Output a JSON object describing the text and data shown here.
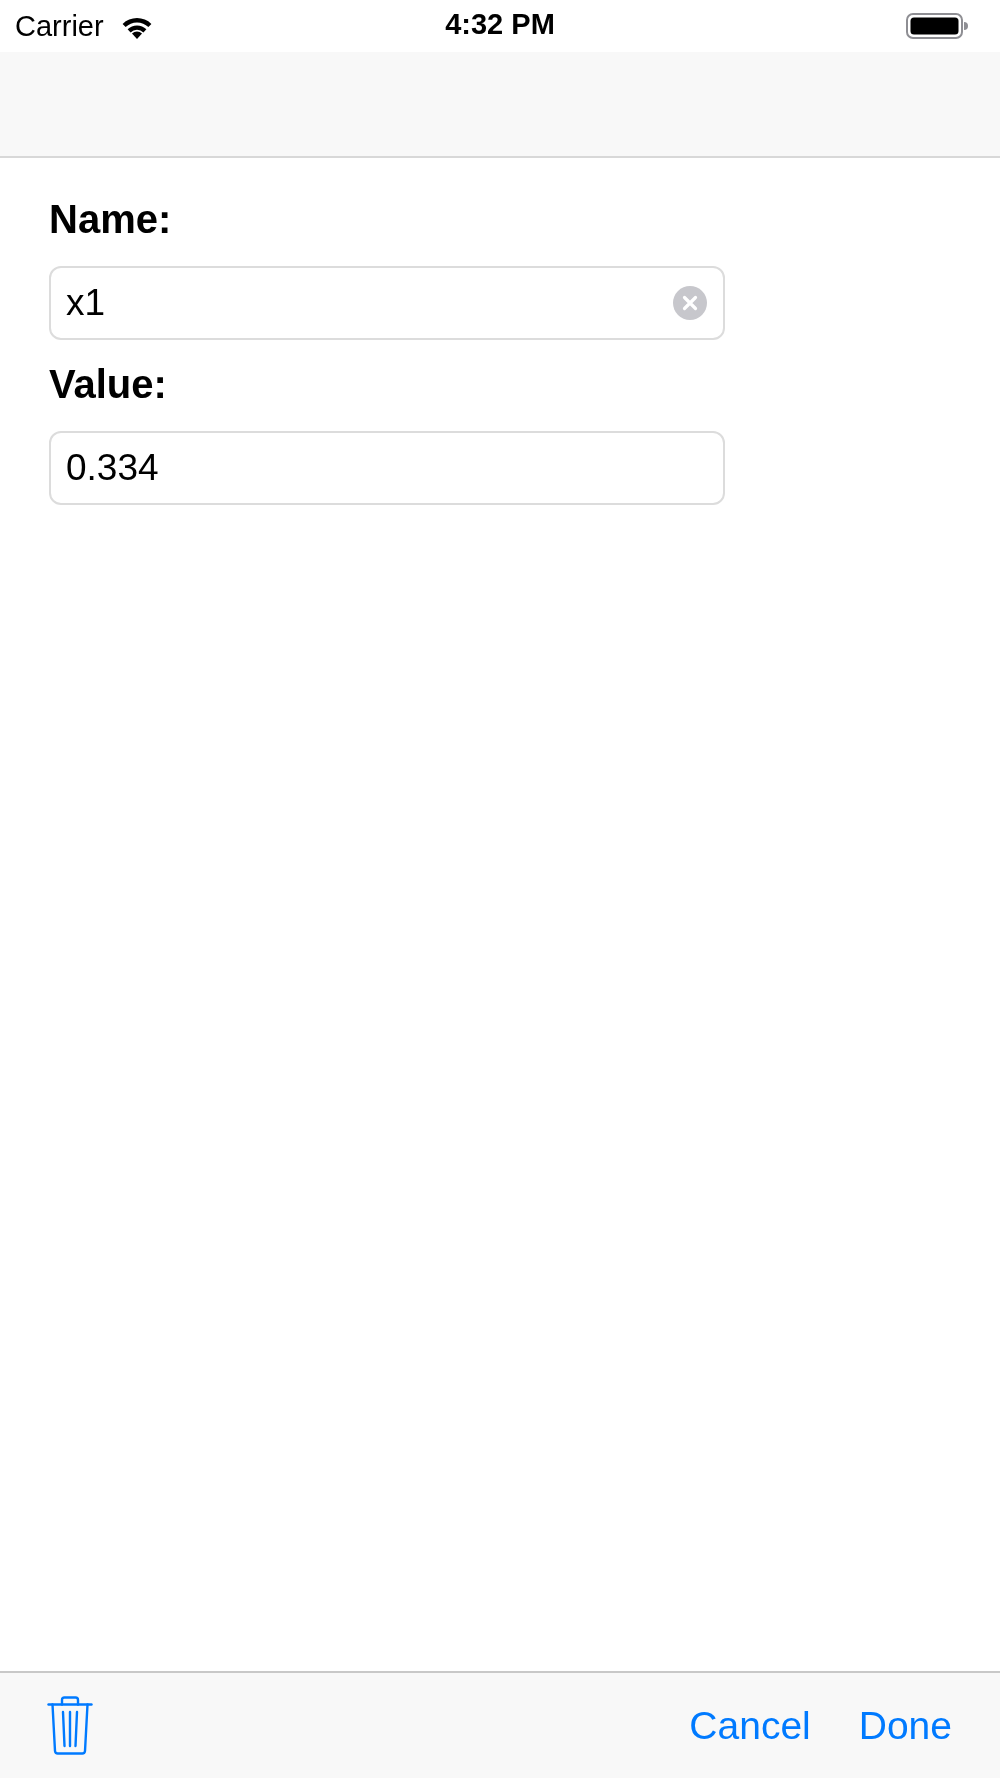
{
  "status_bar": {
    "carrier": "Carrier",
    "time": "4:32 PM"
  },
  "form": {
    "fields": [
      {
        "label": "Name:",
        "value": "x1",
        "clear_button": true
      },
      {
        "label": "Value:",
        "value": "0.334",
        "clear_button": false
      }
    ]
  },
  "toolbar": {
    "buttons": [
      {
        "label": "Cancel"
      },
      {
        "label": "Done"
      }
    ]
  }
}
